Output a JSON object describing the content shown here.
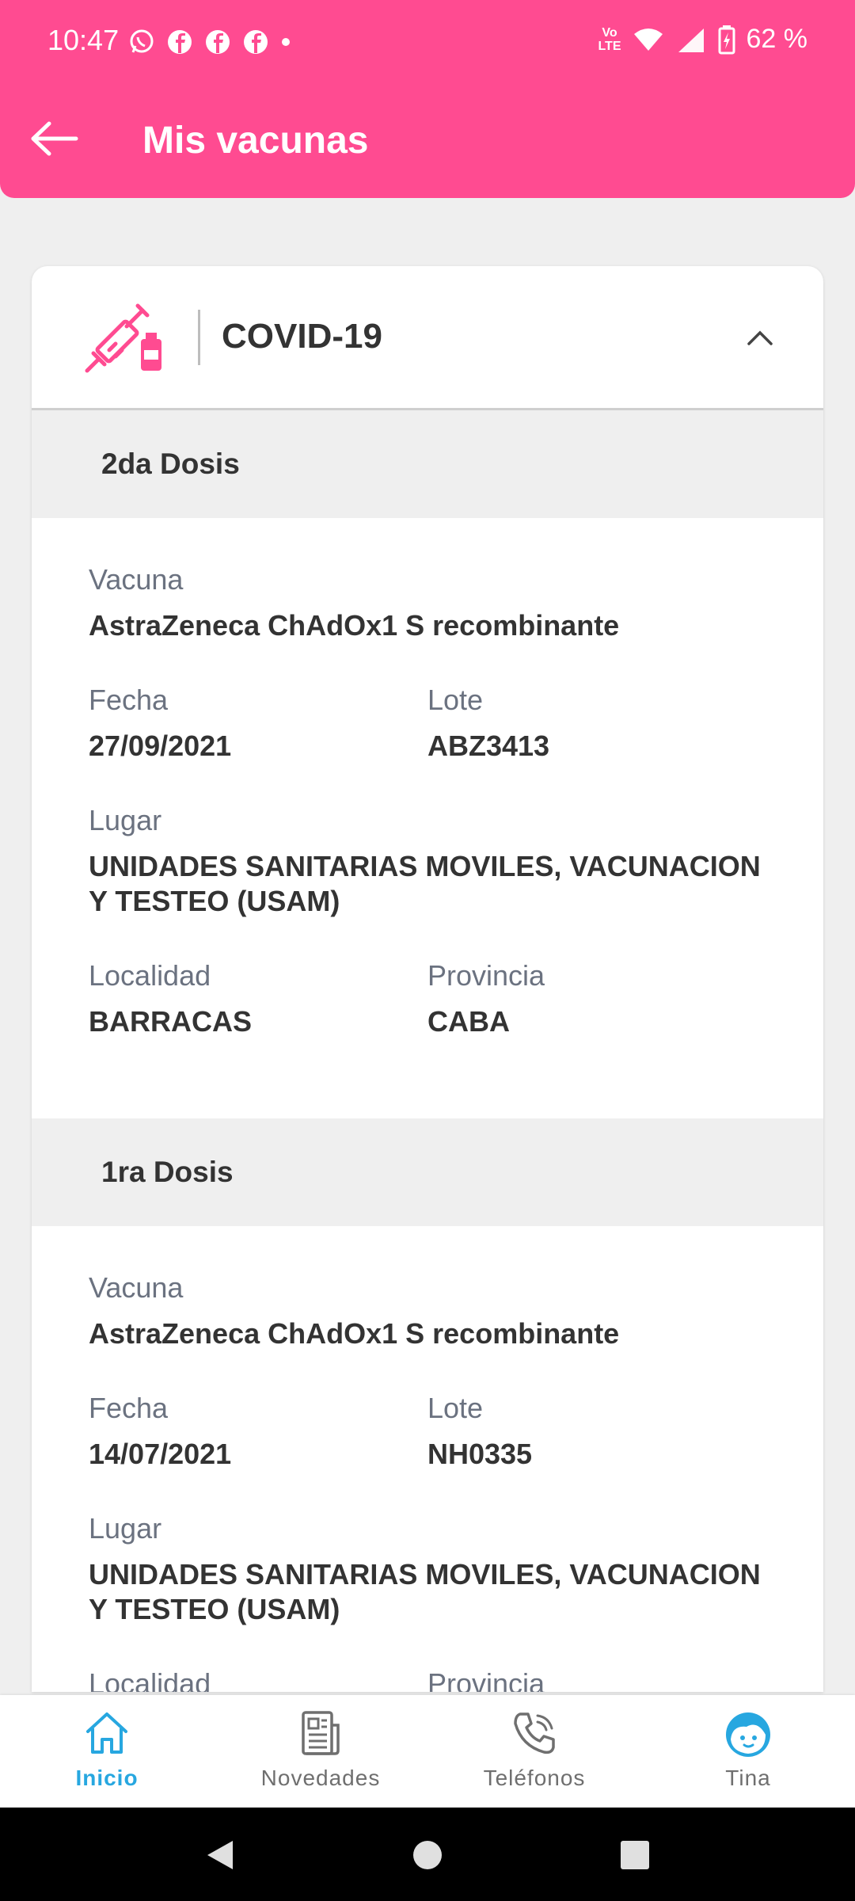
{
  "status": {
    "time": "10:47",
    "volte": "Vo\nLTE",
    "battery": "62 %"
  },
  "header": {
    "title": "Mis vacunas"
  },
  "card": {
    "title": "COVID-19",
    "doses": [
      {
        "heading": "2da Dosis",
        "vacuna_label": "Vacuna",
        "vacuna": "AstraZeneca ChAdOx1 S recombinante",
        "fecha_label": "Fecha",
        "fecha": "27/09/2021",
        "lote_label": "Lote",
        "lote": "ABZ3413",
        "lugar_label": "Lugar",
        "lugar": "UNIDADES SANITARIAS MOVILES, VACUNACION Y TESTEO  (USAM)",
        "localidad_label": "Localidad",
        "localidad": "BARRACAS",
        "provincia_label": "Provincia",
        "provincia": "CABA"
      },
      {
        "heading": "1ra Dosis",
        "vacuna_label": "Vacuna",
        "vacuna": "AstraZeneca ChAdOx1 S recombinante",
        "fecha_label": "Fecha",
        "fecha": "14/07/2021",
        "lote_label": "Lote",
        "lote": "NH0335",
        "lugar_label": "Lugar",
        "lugar": "UNIDADES SANITARIAS MOVILES, VACUNACION Y TESTEO  (USAM)",
        "localidad_label": "Localidad",
        "provincia_label": "Provincia"
      }
    ]
  },
  "bottom_nav": [
    {
      "label": "Inicio",
      "icon": "home-icon",
      "active": true
    },
    {
      "label": "Novedades",
      "icon": "news-icon",
      "active": false
    },
    {
      "label": "Teléfonos",
      "icon": "phone-icon",
      "active": false
    },
    {
      "label": "Tina",
      "icon": "tina-avatar-icon",
      "active": false
    }
  ],
  "colors": {
    "brand_pink": "#ff4b91",
    "active_blue": "#27a7e0",
    "label_gray": "#6b7280"
  }
}
